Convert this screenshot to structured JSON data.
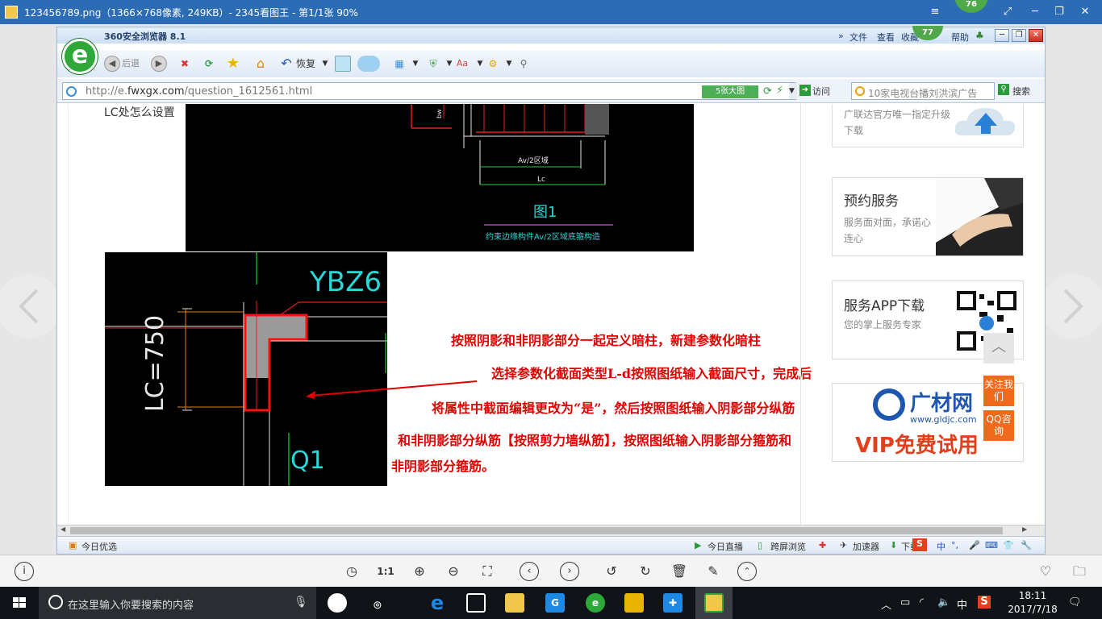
{
  "viewer": {
    "title": "123456789.png（1366×768像素, 249KB）- 2345看图王 - 第1/1张 90%",
    "badge": "76"
  },
  "browser": {
    "title": "360安全浏览器 8.1",
    "menu": {
      "file": "文件",
      "view": "查看",
      "favorites": "收藏",
      "help": "帮助"
    },
    "badge": "77",
    "toolbar": {
      "back": "后退",
      "restore": "恢复"
    },
    "address": {
      "url_prefix": "http://e.",
      "url_domain": "fwxgx.com",
      "url_path": "/question_1612561.html",
      "big_image": "5张大图",
      "visit": "访问",
      "search_text": "10家电视台播刘洪滨广告",
      "search": "搜索"
    }
  },
  "page": {
    "top_text": "LC处怎么设置",
    "cad_top": {
      "dim_av": "Av/2区域",
      "dim_lc": "Lc",
      "fig_label": "图1",
      "caption": "约束边缘构件Av/2区域底箍构造",
      "bw": "bw"
    },
    "cad_main": {
      "ybz": "YBZ6",
      "lc": "LC=750",
      "q1": "Q1"
    },
    "notes": [
      "按照阴影和非阴影部分一起定义暗柱，新建参数化暗柱",
      "选择参数化截面类型L-d按照图纸输入截面尺寸，完成后",
      "将属性中截面编辑更改为“是”，然后按照图纸输入阴影部分纵筋",
      "和非阴影部分纵筋【按照剪力墙纵筋】，按照图纸输入阴影部分箍筋和",
      "非阴影部分箍筋。"
    ],
    "sidebar": {
      "card1_desc": "广联达官方唯一指定升级下载",
      "card2_title": "预约服务",
      "card2_desc": "服务面对面，承诺心连心",
      "card3_title": "服务APP下载",
      "card3_desc": "您的掌上服务专家",
      "card4_brand": "广材网",
      "card4_url": "www.gldjc.com",
      "card4_vip": "VIP免费试用"
    },
    "float": {
      "follow": "关注我们",
      "qq": "QQ咨询"
    }
  },
  "statusbar": {
    "today": "今日优选",
    "live": "今日直播",
    "cross": "跨屏浏览",
    "accelerator": "加速器",
    "download": "下载"
  },
  "viewer_toolbar": {
    "ratio": "1:1"
  },
  "taskbar": {
    "search_placeholder": "在这里输入你要搜索的内容",
    "ime": "中",
    "time": "18:11",
    "date": "2017/7/18"
  },
  "colors": {
    "note_red": "#e00000",
    "cad_cyan": "#2ad6d6",
    "cad_green": "#1ecf3a",
    "accent_orange": "#f06a1c"
  }
}
